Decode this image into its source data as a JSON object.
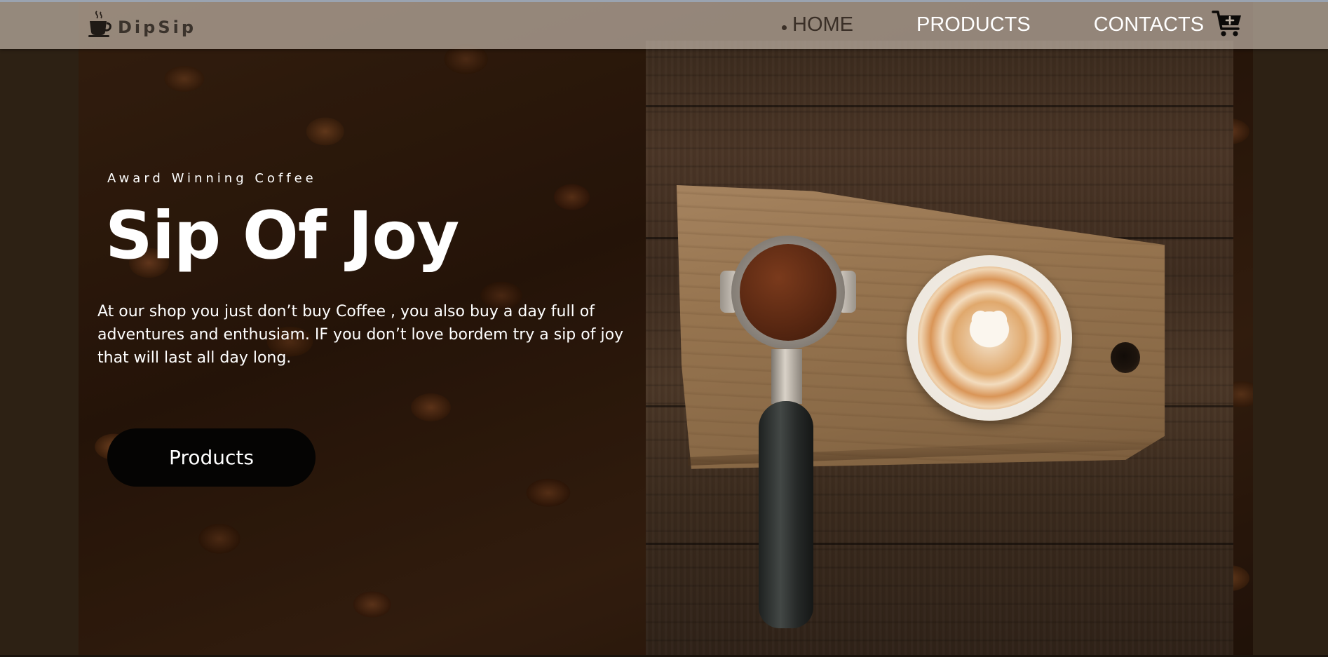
{
  "brand": {
    "name": "DipSip",
    "logo_icon": "coffee-cup-icon"
  },
  "nav": {
    "items": [
      {
        "label": "HOME",
        "active": true
      },
      {
        "label": "PRODUCTS",
        "active": false
      },
      {
        "label": "CONTACTS",
        "active": false
      }
    ],
    "cart_icon": "cart-plus-icon"
  },
  "hero": {
    "subtitle": "Award Winning Coffee",
    "headline": "Sip Of Joy",
    "description": "At our shop you just don’t buy Coffee , you also buy a day full of adventures and enthusiam. IF you don’t love bordem try a sip of joy that will last all day long.",
    "cta_label": "Products",
    "background": "coffee-beans-photo",
    "photo": "latte-and-portafilter-on-wooden-board-photo"
  },
  "colors": {
    "page_background": "#2d2114",
    "navbar": "#beb2a5",
    "button": "#050403",
    "text": "#ffffff",
    "active_nav": "#3a2f27"
  }
}
